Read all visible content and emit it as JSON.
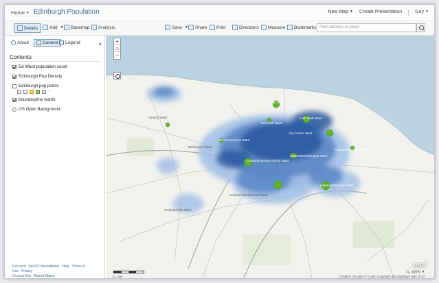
{
  "header": {
    "home_label": "Home",
    "title": "Edinburgh Population",
    "new_map_label": "New Map",
    "create_presentation_label": "Create Presentation",
    "user_label": "Guy"
  },
  "toolbar": {
    "details_label": "Details",
    "add_label": "Add",
    "basemap_label": "Basemap",
    "analysis_label": "Analysis",
    "save_label": "Save",
    "share_label": "Share",
    "print_label": "Print",
    "directions_label": "Directions",
    "measure_label": "Measure",
    "bookmarks_label": "Bookmarks",
    "search_placeholder": "Find address or place"
  },
  "panel": {
    "tabs": [
      {
        "label": "About"
      },
      {
        "label": "Content"
      },
      {
        "label": "Legend"
      }
    ],
    "heading": "Contents",
    "layers": [
      {
        "label": "Ed Ward population count",
        "checked": true
      },
      {
        "label": "Edinburgh Pop Density",
        "checked": true
      },
      {
        "label": "Edinburgh pop points",
        "checked": false
      },
      {
        "label": "boundaryline wards",
        "checked": true
      },
      {
        "label": "OS Open Background",
        "checked": false
      }
    ],
    "footer": [
      "Esri.com",
      "ArcGIS Marketplace",
      "Help",
      "Terms of Use",
      "Privacy",
      "Contact Esri",
      "Report Abuse"
    ]
  },
  "map": {
    "places": [
      {
        "label": "Almond Ward"
      },
      {
        "label": "Edinburgh Airport"
      },
      {
        "label": "Leith Ward"
      },
      {
        "label": "Leith Walk Ward"
      },
      {
        "label": "Inverleith Ward"
      },
      {
        "label": "City Centre Ward"
      },
      {
        "label": "Drum Brae/Gyle Ward"
      },
      {
        "label": "Corstorphine/Murrayfield Ward"
      },
      {
        "label": "Southside/Newington Ward"
      },
      {
        "label": "Portobello/Craigmillar Ward"
      },
      {
        "label": "Liberton/Gilmerton Ward"
      },
      {
        "label": "Pentland Hills Ward"
      },
      {
        "label": "Colinton/Fairmilehead Ward"
      }
    ],
    "scale_label": "0   1   2km",
    "attribution": "Contains OS data © Crown Copyright and database right 2013",
    "esri_logo": "esri",
    "zoom_level": "100%"
  },
  "colors": {
    "water": "#b9d3e1",
    "density_high": "#2b5aa0",
    "density_mid": "#5a87c7",
    "density_low": "#9dbde6",
    "ward_point": "#5fb32e"
  }
}
